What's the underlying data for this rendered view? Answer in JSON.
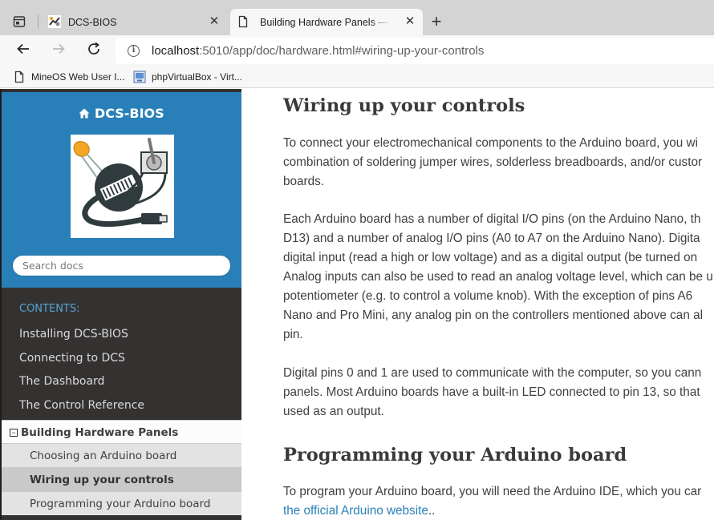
{
  "browser": {
    "tabs": [
      {
        "title": "DCS-BIOS",
        "close": "✕"
      },
      {
        "title": "Building Hardware Panels — DCS-BIOS",
        "close": "✕"
      }
    ],
    "new_tab": "+",
    "url_host": "localhost",
    "url_rest": ":5010/app/doc/hardware.html#wiring-up-your-controls",
    "bookmarks": [
      {
        "label": "MineOS Web User I...",
        "icon": "document-icon"
      },
      {
        "label": "phpVirtualBox - Virt...",
        "icon": "virtualbox-icon"
      }
    ]
  },
  "sidebar": {
    "logo_text": "DCS-BIOS",
    "search_placeholder": "Search docs",
    "contents_caption": "CONTENTS:",
    "toc": [
      "Installing DCS-BIOS",
      "Connecting to DCS",
      "The Dashboard",
      "The Control Reference"
    ],
    "current": {
      "toggle": "−",
      "label": "Building Hardware Panels"
    },
    "subitems": [
      {
        "label": "Choosing an Arduino board"
      },
      {
        "label": "Wiring up your controls"
      },
      {
        "label": "Programming your Arduino board"
      }
    ]
  },
  "content": {
    "heading1": "Wiring up your controls",
    "p1": [
      "To connect your electromechanical components to the Arduino board, you wi",
      "combination of soldering jumper wires, solderless breadboards, and/or custor",
      "boards."
    ],
    "p2": [
      "Each Arduino board has a number of digital I/O pins (on the Arduino Nano, th",
      "D13) and a number of analog I/O pins (A0 to A7 on the Arduino Nano). Digita",
      "digital input (read a high or low voltage) and as a digital output (be turned on",
      "Analog inputs can also be used to read an analog voltage level, which can be u",
      "potentiometer (e.g. to control a volume knob). With the exception of pins A6",
      "Nano and Pro Mini, any analog pin on the controllers mentioned above can al",
      "pin."
    ],
    "p3": [
      "Digital pins 0 and 1 are used to communicate with the computer, so you cann",
      "panels. Most Arduino boards have a built-in LED connected to pin 13, so that",
      "used as an output."
    ],
    "heading2": "Programming your Arduino board",
    "p4_line1": "To program your Arduino board, you will need the Arduino IDE, which you car",
    "p4_link": "the official Arduino website",
    "p4_tail": ".."
  },
  "colors": {
    "sidebar_head": "#2980b9",
    "sidebar_bg": "#343131",
    "link": "#2980b9",
    "contents_caption": "#55a5d9"
  }
}
